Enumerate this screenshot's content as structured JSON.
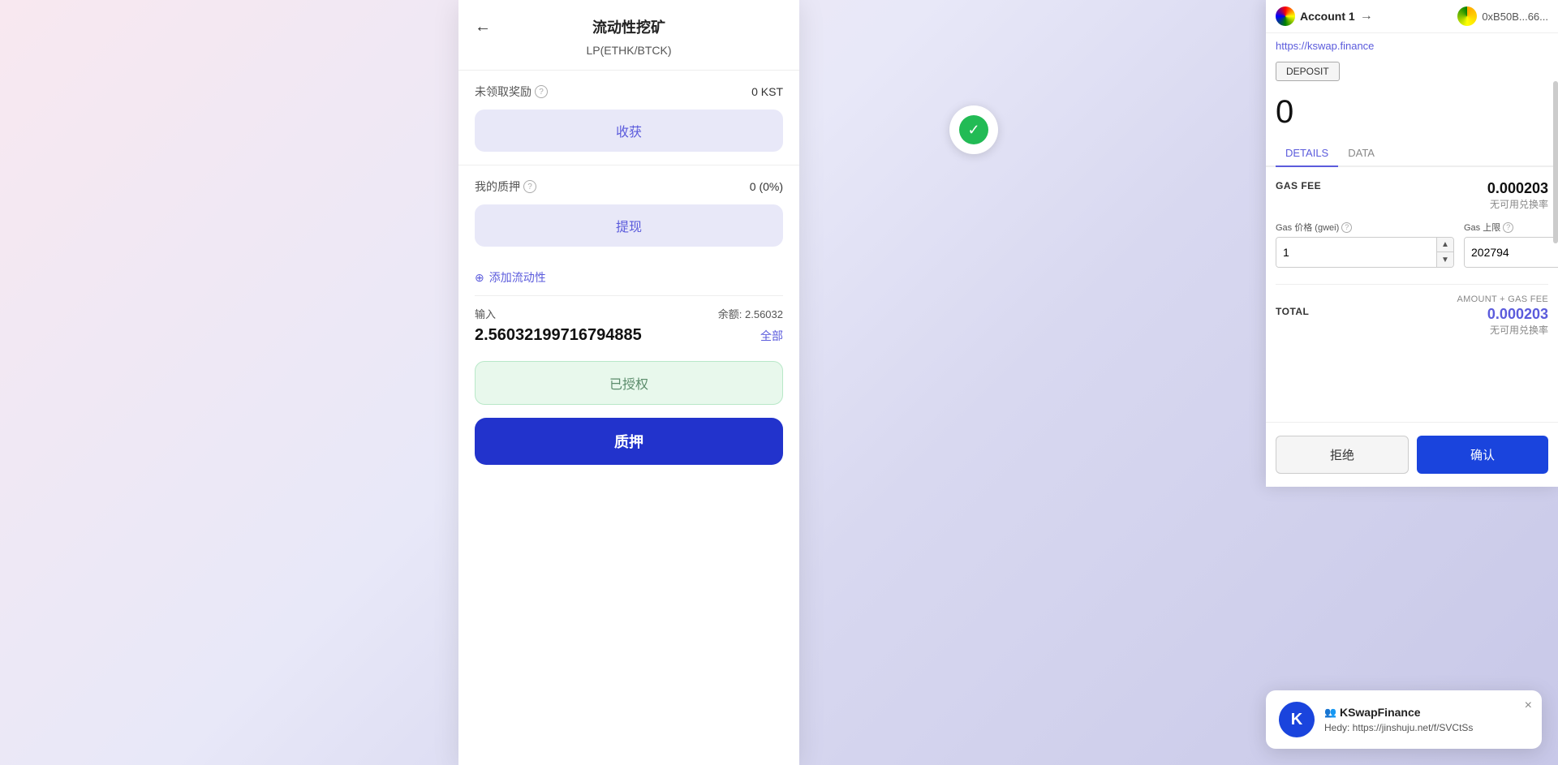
{
  "background": {
    "gradient": "linear-gradient(135deg, #f8e8f0 0%, #e8e8f8 40%, #d8d8f0 60%, #c8c8e8 100%)"
  },
  "main_card": {
    "title": "流动性挖矿",
    "subtitle": "LP(ETHK/BTCK)",
    "back_icon": "←",
    "sections": {
      "unclaimed": {
        "label": "未领取奖励",
        "value": "0 KST",
        "btn_harvest": "收获"
      },
      "my_stake": {
        "label": "我的质押",
        "value": "0 (0%)",
        "btn_withdraw": "提现"
      },
      "add_liquidity": {
        "label": "添加流动性",
        "plus_icon": "⊕"
      },
      "input": {
        "label": "输入",
        "balance_label": "余额: 2.56032",
        "amount": "2.56032199716794885",
        "btn_max": "全部"
      },
      "btn_authorized": "已授权",
      "btn_stake": "质押"
    }
  },
  "wallet_panel": {
    "account_name": "Account 1",
    "arrow_icon": "→",
    "address": "0xB50B...66...",
    "url": "https://kswap.finance",
    "deposit_btn": "DEPOSIT",
    "balance": "0",
    "tabs": [
      {
        "label": "DETAILS",
        "active": true
      },
      {
        "label": "DATA",
        "active": false
      }
    ],
    "details": {
      "gas_fee_label": "GAS FEE",
      "gas_fee_value": "0.000203",
      "gas_no_exchange": "无可用兑换率",
      "gas_price_label": "Gas 价格 (gwei)",
      "gas_price_value": "1",
      "gas_limit_label": "Gas 上限",
      "gas_limit_value": "202794",
      "amount_gas_label": "AMOUNT + GAS FEE",
      "total_label": "TOTAL",
      "total_value": "0.000203",
      "total_no_exchange": "无可用兑换率"
    },
    "btn_reject": "拒绝",
    "btn_confirm": "确认"
  },
  "notification": {
    "app_name": "KSwapFinance",
    "people_icon": "👥",
    "message": "Hedy: https://jinshuju.net/f/SVCtSs",
    "close_icon": "×",
    "logo_text": "K"
  },
  "green_check": {
    "icon": "✓"
  }
}
